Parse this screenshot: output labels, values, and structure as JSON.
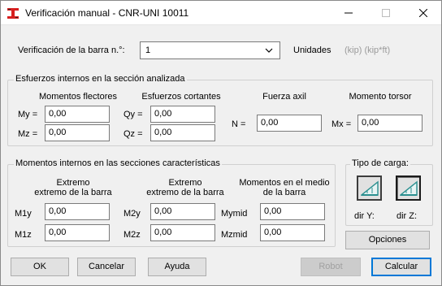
{
  "window": {
    "title": "Verificación manual - CNR-UNI 10011",
    "controls": [
      "minimize",
      "maximize",
      "close"
    ]
  },
  "header": {
    "bar_label": "Verificación de la barra n.°:",
    "bar_value": "1",
    "units_label": "Unidades",
    "units_value": "(kip) (kip*ft)"
  },
  "internal_forces": {
    "title": "Esfuerzos internos en la sección analizada",
    "bending": {
      "heading": "Momentos flectores",
      "my_label": "My =",
      "my_value": "0,00",
      "mz_label": "Mz =",
      "mz_value": "0,00"
    },
    "shear": {
      "heading": "Esfuerzos cortantes",
      "qy_label": "Qy =",
      "qy_value": "0,00",
      "qz_label": "Qz =",
      "qz_value": "0,00"
    },
    "axial": {
      "heading": "Fuerza axil",
      "n_label": "N =",
      "n_value": "0,00"
    },
    "torsion": {
      "heading": "Momento torsor",
      "mx_label": "Mx =",
      "mx_value": "0,00"
    }
  },
  "characteristic_moments": {
    "title": "Momentos internos en las secciones características",
    "col1": {
      "heading_line1": "Extremo",
      "heading_line2": "extremo de la barra",
      "r1_label": "M1y",
      "r1_value": "0,00",
      "r2_label": "M1z",
      "r2_value": "0,00"
    },
    "col2": {
      "heading_line1": "Extremo",
      "heading_line2": "extremo de la barra",
      "r1_label": "M2y",
      "r1_value": "0,00",
      "r2_label": "M2z",
      "r2_value": "0,00"
    },
    "col3": {
      "heading_line1": "Momentos en el medio",
      "heading_line2": "de la barra",
      "r1_label": "Mymid",
      "r1_value": "0,00",
      "r2_label": "Mzmid",
      "r2_value": "0,00"
    }
  },
  "load_type": {
    "title": "Tipo de carga:",
    "dir_y_label": "dir Y:",
    "dir_z_label": "dir Z:",
    "options_button": "Opciones"
  },
  "footer": {
    "ok": "OK",
    "cancel": "Cancelar",
    "help": "Ayuda",
    "robot": "Robot",
    "calculate": "Calcular"
  },
  "colors": {
    "accent": "#0078d7",
    "app_icon_red": "#d81e1e",
    "load_icon_teal": "#2a8f8f",
    "disabled_text": "#a0a0a0"
  }
}
